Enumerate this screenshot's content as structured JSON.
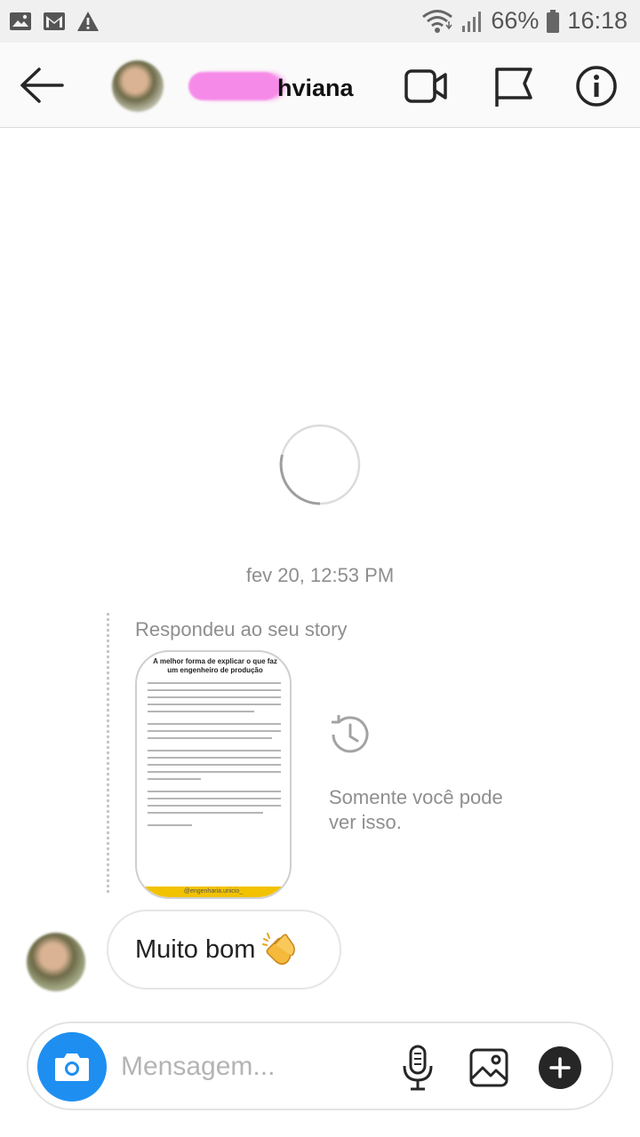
{
  "status_bar": {
    "battery": "66%",
    "time": "16:18",
    "icons": [
      "gallery-notification-icon",
      "gmail-icon",
      "warning-icon",
      "wifi-icon",
      "signal-icon",
      "battery-icon"
    ]
  },
  "header": {
    "username_visible": "hviana",
    "icons": [
      "back-arrow-icon",
      "video-call-icon",
      "flag-icon",
      "info-icon"
    ]
  },
  "thread": {
    "timestamp": "fev 20, 12:53 PM",
    "story_reply": {
      "label": "Respondeu ao seu story",
      "story_title": "A melhor forma de explicar o que faz um engenheiro de produção",
      "story_footer": "@engenharia.unicio_",
      "only_you_note": "Somente você pode ver isso."
    },
    "messages": [
      {
        "text": "Muito bom",
        "emoji": "clapping-hands"
      }
    ]
  },
  "composer": {
    "placeholder": "Mensagem...",
    "accent": "#1e8ff0"
  }
}
